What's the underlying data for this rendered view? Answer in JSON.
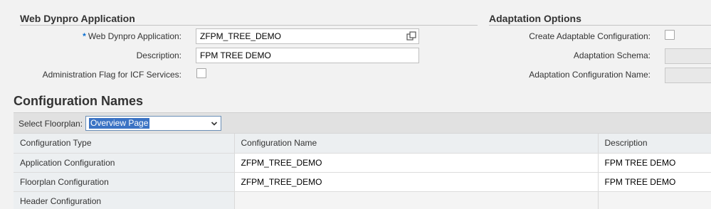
{
  "web_dynpro": {
    "title": "Web Dynpro Application",
    "fields": {
      "app_label": "Web Dynpro Application:",
      "app_required_mark": "*",
      "app_value": "ZFPM_TREE_DEMO",
      "desc_label": "Description:",
      "desc_value": "FPM TREE DEMO",
      "admin_flag_label": "Administration Flag for ICF Services:",
      "admin_flag_checked": false
    }
  },
  "adaptation": {
    "title": "Adaptation Options",
    "create_label": "Create Adaptable Configuration:",
    "create_checked": false,
    "schema_label": "Adaptation Schema:",
    "schema_value": "",
    "config_name_label": "Adaptation Configuration Name:",
    "config_name_value": ""
  },
  "config_names": {
    "title": "Configuration Names",
    "floorplan_label": "Select Floorplan:",
    "floorplan_selected": "Overview Page",
    "columns": [
      "Configuration Type",
      "Configuration Name",
      "Description"
    ],
    "rows": [
      {
        "type": "Application Configuration",
        "name": "ZFPM_TREE_DEMO",
        "description": "FPM TREE DEMO"
      },
      {
        "type": "Floorplan Configuration",
        "name": "ZFPM_TREE_DEMO",
        "description": "FPM TREE DEMO"
      },
      {
        "type": "Header Configuration",
        "name": "",
        "description": ""
      }
    ]
  },
  "icons": {
    "value_help": "value-help-icon",
    "dropdown": "chevron-down-icon"
  },
  "colors": {
    "accent": "#0a6ed1",
    "selection": "#3b73c4",
    "background": "#f2f2f2"
  }
}
